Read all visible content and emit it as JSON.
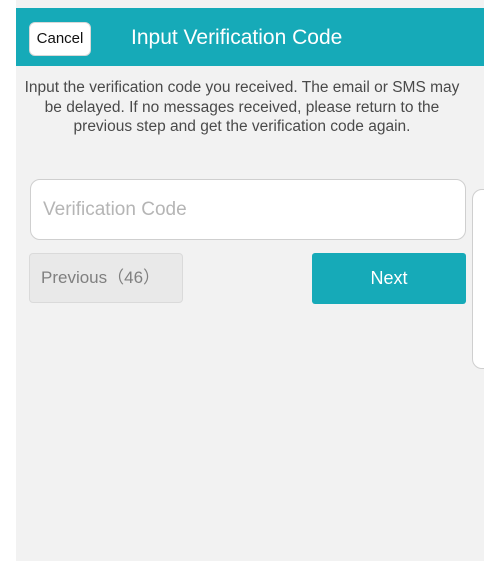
{
  "header": {
    "cancel_label": "Cancel",
    "title": "Input Verification Code"
  },
  "instructions": "Input the verification code you received. The email or SMS may be delayed. If no messages received, please return to the previous step and get the verification code again.",
  "code_input": {
    "value": "",
    "placeholder": "Verification Code"
  },
  "actions": {
    "previous_label": "Previous（46）",
    "next_label": "Next"
  },
  "colors": {
    "accent": "#16aab8",
    "background": "#f2f2f2"
  }
}
